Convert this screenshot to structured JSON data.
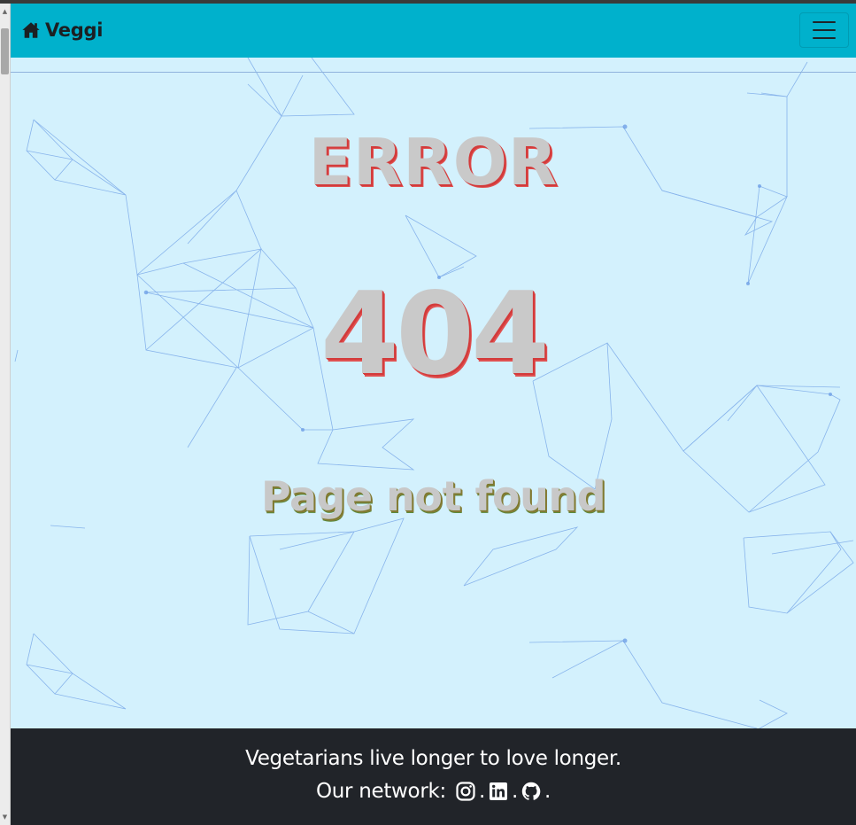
{
  "navbar": {
    "brand_label": "Veggi",
    "brand_icon": "home-icon",
    "toggler_icon": "hamburger-menu-icon",
    "background_color": "#00b1cc"
  },
  "error": {
    "title": "ERROR",
    "code": "404",
    "message": "Page not found"
  },
  "footer": {
    "tagline": "Vegetarians live longer to love longer.",
    "network_label": "Our network:",
    "separator": ".",
    "social_icons": [
      "instagram-icon",
      "linkedin-icon",
      "github-icon"
    ]
  },
  "colors": {
    "hero_background": "#d3f1fd",
    "footer_background": "#212429",
    "text_shadow_red": "#d33b3b"
  }
}
